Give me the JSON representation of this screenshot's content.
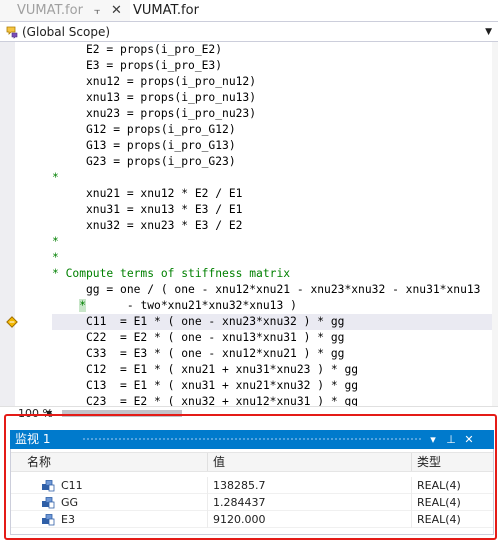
{
  "tabs": [
    {
      "label": "VUMAT.for",
      "pin_icon": "pin-icon",
      "close_icon": "close-icon"
    },
    {
      "label": "VUMAT.for"
    }
  ],
  "scope": {
    "icon": "scope-icon",
    "label": "(Global Scope)"
  },
  "code": {
    "lines": [
      {
        "text": "     E2 = props(i_pro_E2)",
        "kind": "code"
      },
      {
        "text": "     E3 = props(i_pro_E3)",
        "kind": "code"
      },
      {
        "text": "     xnu12 = props(i_pro_nu12)",
        "kind": "code"
      },
      {
        "text": "     xnu13 = props(i_pro_nu13)",
        "kind": "code"
      },
      {
        "text": "     xnu23 = props(i_pro_nu23)",
        "kind": "code"
      },
      {
        "text": "     G12 = props(i_pro_G12)",
        "kind": "code"
      },
      {
        "text": "     G13 = props(i_pro_G13)",
        "kind": "code"
      },
      {
        "text": "     G23 = props(i_pro_G23)",
        "kind": "code"
      },
      {
        "text": "*",
        "kind": "comment"
      },
      {
        "text": "     xnu21 = xnu12 * E2 / E1",
        "kind": "code"
      },
      {
        "text": "     xnu31 = xnu13 * E3 / E1",
        "kind": "code"
      },
      {
        "text": "     xnu32 = xnu23 * E3 / E2",
        "kind": "code"
      },
      {
        "text": "*",
        "kind": "comment"
      },
      {
        "text": "*",
        "kind": "comment"
      },
      {
        "text": "* Compute terms of stiffness matrix",
        "kind": "comment"
      },
      {
        "text": "     gg = one / ( one - xnu12*xnu21 - xnu23*xnu32 - xnu31*xnu13",
        "kind": "code"
      },
      {
        "text": "    *      - two*xnu21*xnu32*xnu13 )",
        "kind": "continuation"
      },
      {
        "text": "     C11  = E1 * ( one - xnu23*xnu32 ) * gg",
        "kind": "current"
      },
      {
        "text": "     C22  = E2 * ( one - xnu13*xnu31 ) * gg",
        "kind": "code"
      },
      {
        "text": "     C33  = E3 * ( one - xnu12*xnu21 ) * gg",
        "kind": "code"
      },
      {
        "text": "     C12  = E1 * ( xnu21 + xnu31*xnu23 ) * gg",
        "kind": "code"
      },
      {
        "text": "     C13  = E1 * ( xnu31 + xnu21*xnu32 ) * gg",
        "kind": "code"
      },
      {
        "text": "     C23  = E2 * ( xnu32 + xnu12*xnu31 ) * gg",
        "kind": "code"
      }
    ],
    "breakpoint_icon": "breakpoint-arrow-icon"
  },
  "zoom": {
    "label": "100 %"
  },
  "watch": {
    "title": "监视 1",
    "buttons": {
      "dropdown": "▾",
      "pin": "⊥",
      "close": "✕"
    },
    "columns": {
      "name": "名称",
      "value": "值",
      "type": "类型"
    },
    "rows": [
      {
        "name": "C11",
        "value": "138285.7",
        "type": "REAL(4)"
      },
      {
        "name": "GG",
        "value": "1.284437",
        "type": "REAL(4)"
      },
      {
        "name": "E3",
        "value": "9120.000",
        "type": "REAL(4)"
      }
    ],
    "row_icon": "variable-icon"
  },
  "colors": {
    "accent": "#007acc",
    "highlight_box": "#e41b17",
    "comment": "#008000"
  }
}
